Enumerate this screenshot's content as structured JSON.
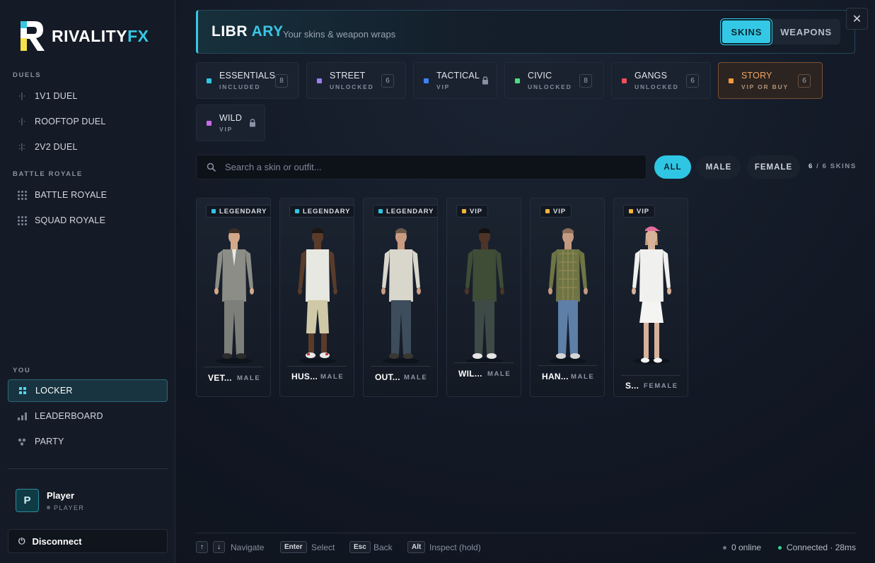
{
  "brand": {
    "name_main": "RIVALITY",
    "name_accent": "FX"
  },
  "sidebar": {
    "sections": [
      {
        "label": "DUELS",
        "items": [
          {
            "label": "1V1 DUEL",
            "icon": "duel-dots-icon"
          },
          {
            "label": "ROOFTOP DUEL",
            "icon": "duel-dots-icon"
          },
          {
            "label": "2V2 DUEL",
            "icon": "team-dots-icon"
          }
        ]
      },
      {
        "label": "BATTLE ROYALE",
        "items": [
          {
            "label": "BATTLE ROYALE",
            "icon": "grid-dots-icon"
          },
          {
            "label": "SQUAD ROYALE",
            "icon": "grid-dots-icon"
          }
        ]
      },
      {
        "label": "YOU",
        "items": [
          {
            "label": "LOCKER",
            "icon": "grid-squares-icon",
            "active": true
          },
          {
            "label": "LEADERBOARD",
            "icon": "bar-chart-icon"
          },
          {
            "label": "PARTY",
            "icon": "people-dots-icon"
          }
        ]
      }
    ],
    "player": {
      "initial": "P",
      "name": "Player",
      "role": "PLAYER"
    },
    "disconnect_label": "Disconnect"
  },
  "header": {
    "title_a": "LIBR",
    "title_b": "ARY",
    "subtitle": "Your skins & weapon wraps",
    "tabs": [
      {
        "label": "SKINS",
        "active": true
      },
      {
        "label": "WEAPONS",
        "active": false
      }
    ],
    "close_symbol": "✕"
  },
  "categories": [
    {
      "name": "ESSENTIALS",
      "status": "INCLUDED",
      "count": "8",
      "color": "#2fc6e4"
    },
    {
      "name": "STREET",
      "status": "UNLOCKED",
      "count": "6",
      "color": "#9b7ff2"
    },
    {
      "name": "TACTICAL",
      "status": "VIP",
      "locked": true,
      "color": "#3b82f6"
    },
    {
      "name": "CIVIC",
      "status": "UNLOCKED",
      "count": "8",
      "color": "#4ade80"
    },
    {
      "name": "GANGS",
      "status": "UNLOCKED",
      "count": "6",
      "color": "#ef4f5a"
    },
    {
      "name": "STORY",
      "status": "VIP OR BUY",
      "count": "6",
      "color": "#f59a3a",
      "active": true
    },
    {
      "name": "WILD",
      "status": "VIP",
      "locked": true,
      "color": "#c86ae8"
    }
  ],
  "search": {
    "placeholder": "Search a skin or outfit...",
    "value": ""
  },
  "filters": [
    {
      "label": "ALL",
      "active": true
    },
    {
      "label": "MALE",
      "active": false
    },
    {
      "label": "FEMALE",
      "active": false
    }
  ],
  "skin_count": {
    "shown": "6",
    "sep": "/",
    "total": "6 SKINS"
  },
  "skins": [
    {
      "tier": "LEGENDARY",
      "tier_color": "#2fc6e4",
      "name": "VET...",
      "gender": "MALE",
      "outfit": "suit"
    },
    {
      "tier": "LEGENDARY",
      "tier_color": "#2fc6e4",
      "name": "HUS...",
      "gender": "MALE",
      "outfit": "tank"
    },
    {
      "tier": "LEGENDARY",
      "tier_color": "#2fc6e4",
      "name": "OUT...",
      "gender": "MALE",
      "outfit": "tee"
    },
    {
      "tier": "VIP",
      "tier_color": "#f5b43a",
      "name": "WIL...",
      "gender": "MALE",
      "outfit": "shirt"
    },
    {
      "tier": "VIP",
      "tier_color": "#f5b43a",
      "name": "HAN...",
      "gender": "MALE",
      "outfit": "plaid"
    },
    {
      "tier": "VIP",
      "tier_color": "#f5b43a",
      "name": "S...",
      "gender": "FEMALE",
      "outfit": "tennis"
    }
  ],
  "footer": {
    "hints": [
      {
        "keys": [
          "↑",
          "↓"
        ],
        "label": "Navigate"
      },
      {
        "keys": [
          "Enter"
        ],
        "label": "Select"
      },
      {
        "keys": [
          "Esc"
        ],
        "label": "Back"
      },
      {
        "keys": [
          "Alt"
        ],
        "label": "Inspect (hold)"
      }
    ],
    "online": "0 online",
    "connection": "Connected · 28ms"
  }
}
